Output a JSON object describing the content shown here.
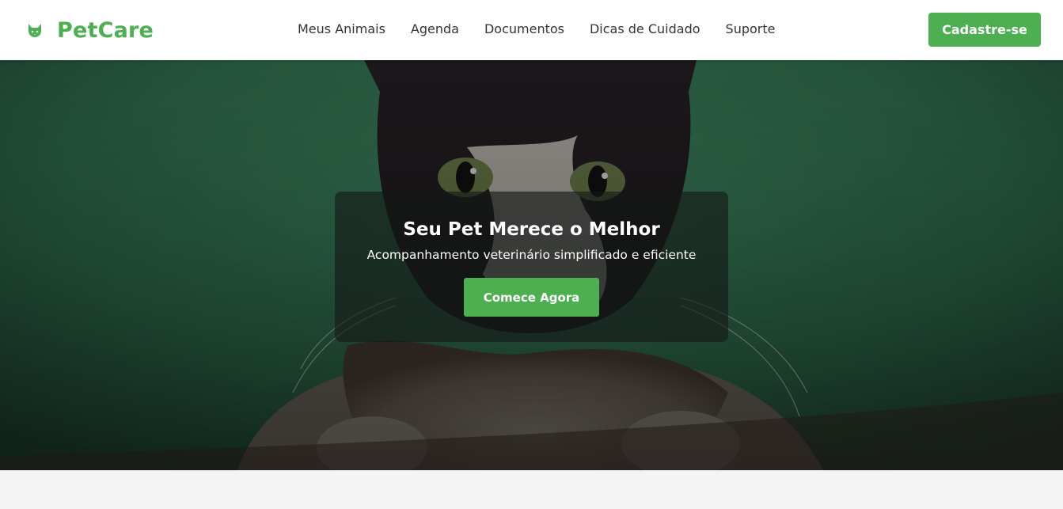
{
  "brand": {
    "name": "PetCare",
    "icon": "cat-icon",
    "color": "#4caf50"
  },
  "nav": {
    "links": [
      "Meus Animais",
      "Agenda",
      "Documentos",
      "Dicas de Cuidado",
      "Suporte"
    ],
    "signup_label": "Cadastre-se"
  },
  "hero": {
    "image": "cat-photo",
    "title": "Seu Pet Merece o Melhor",
    "subtitle": "Acompanhamento veterinário simplificado e eficiente",
    "cta_label": "Comece Agora"
  },
  "colors": {
    "accent": "#4caf50",
    "background": "#f4f4f4"
  }
}
